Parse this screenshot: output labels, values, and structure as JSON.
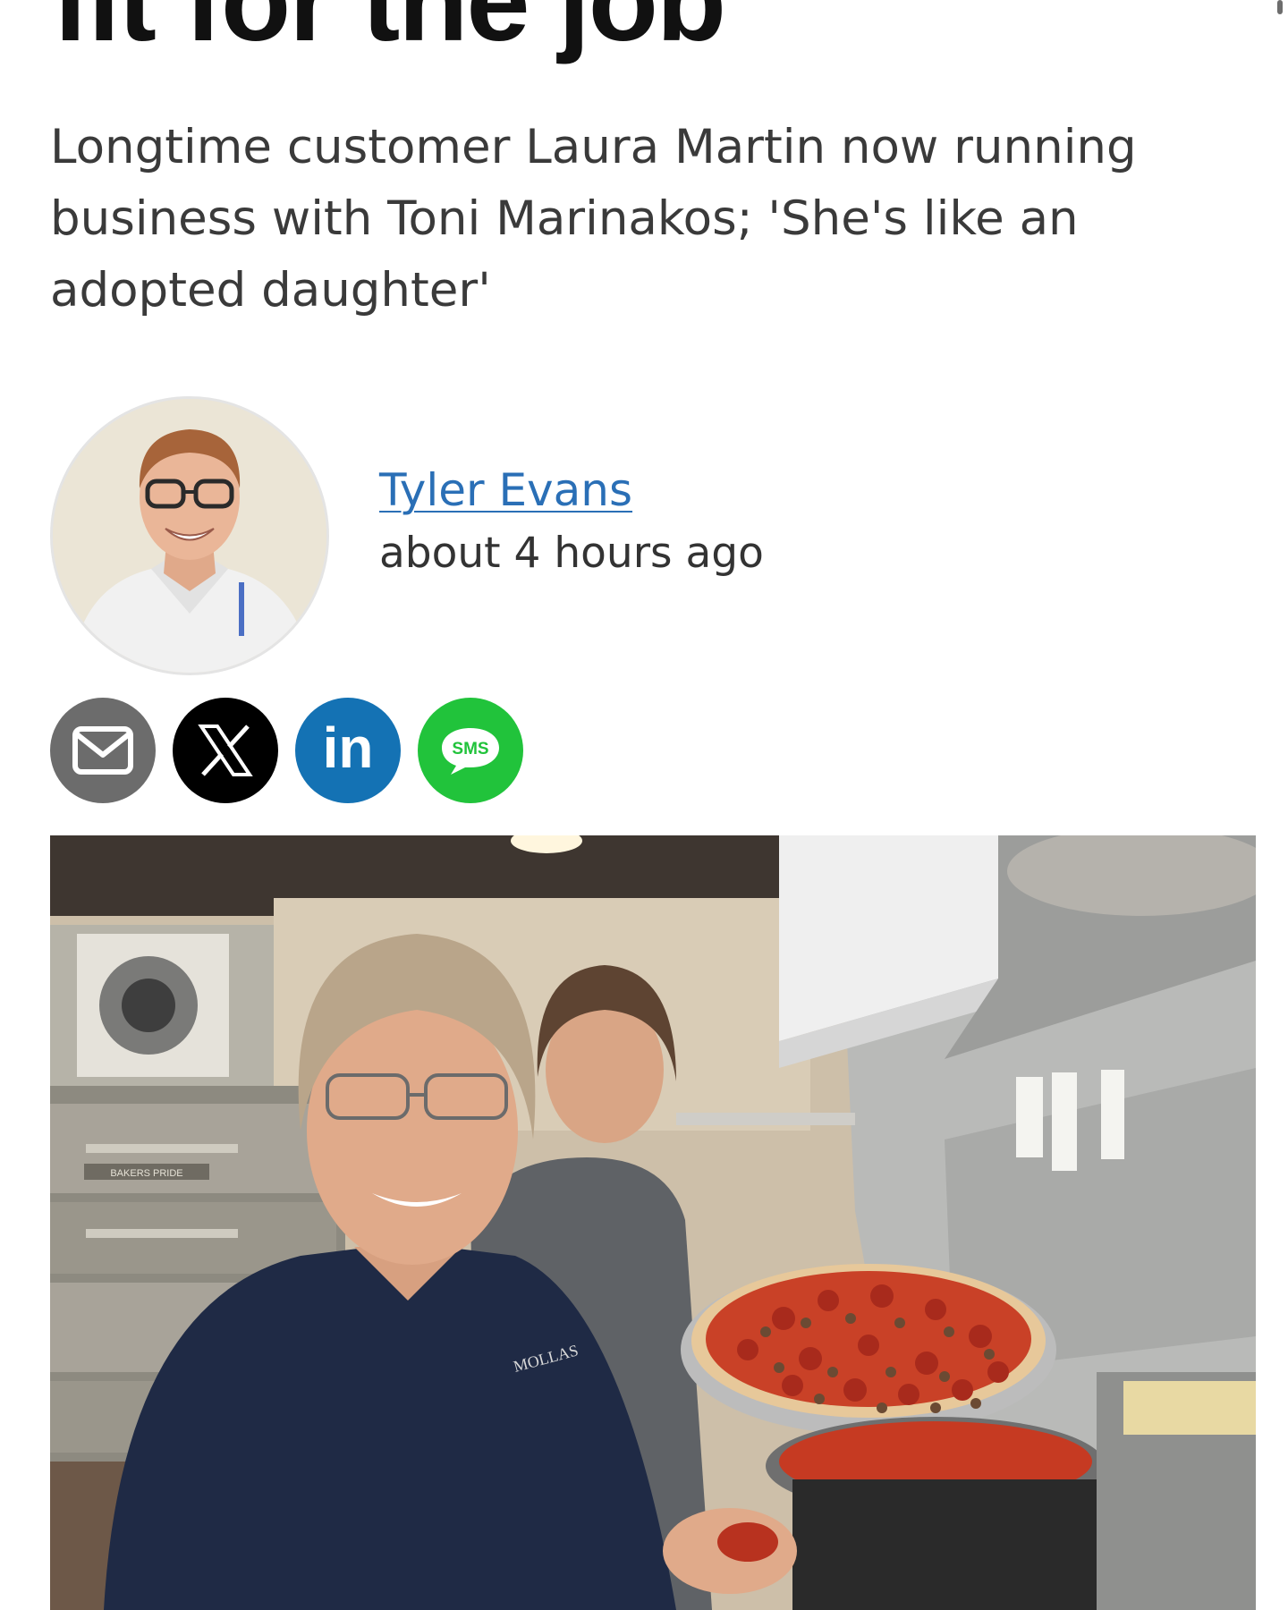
{
  "article": {
    "headline": "fit for the job",
    "subheadline": "Longtime customer Laura Martin now running business with Toni Marinakos; 'She's like an adopted daughter'"
  },
  "byline": {
    "author_name": "Tyler Evans",
    "timestamp": "about 4 hours ago"
  },
  "share": {
    "email_icon": "mail-icon",
    "x_icon": "x-logo-icon",
    "linkedin_label": "in",
    "sms_label": "SMS"
  },
  "photo": {
    "oven_label": "BAKERS PRIDE",
    "shirt_logo": "MOLLAS"
  },
  "colors": {
    "author_link": "#2a6fb6",
    "email_button": "#6c6c6c",
    "x_button": "#000000",
    "linkedin_button": "#1472b4",
    "sms_button": "#21c33b"
  }
}
